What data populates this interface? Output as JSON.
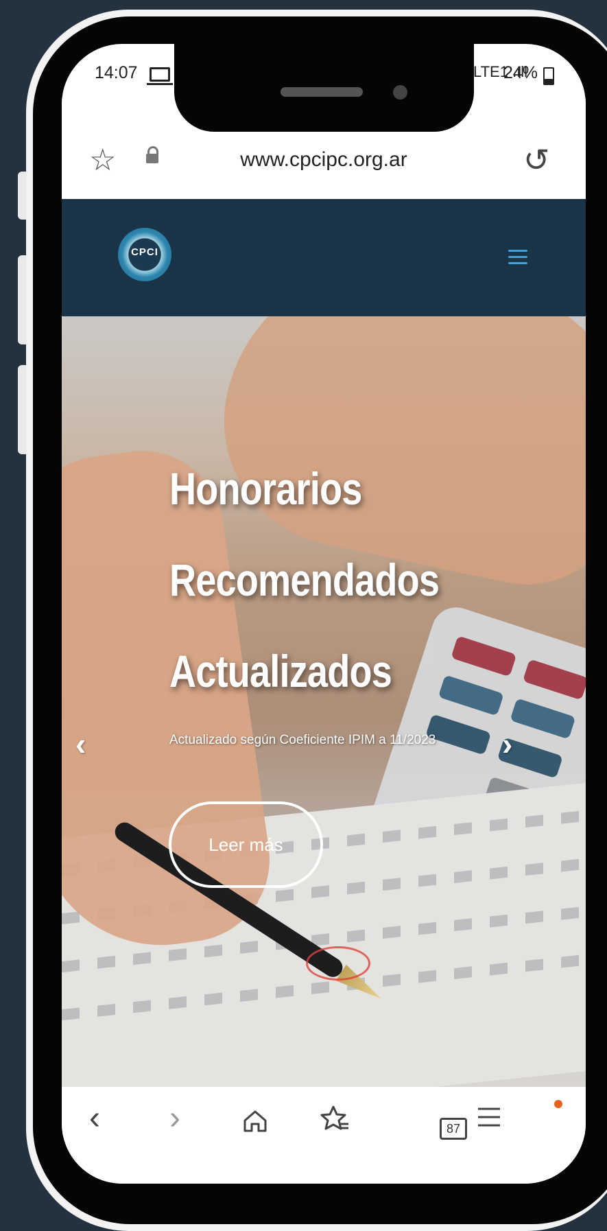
{
  "status_bar": {
    "time": "14:07",
    "signal_text": "LTE1 .ıll",
    "battery": "24%"
  },
  "browser": {
    "url": "www.cpcipc.org.ar",
    "tabs_count": "87",
    "icons": {
      "bookmark": "star-icon",
      "secure": "lock-icon",
      "reload": "reload-icon",
      "back": "back-icon",
      "forward": "forward-icon",
      "home": "home-icon",
      "bookmarks": "bookmarks-icon",
      "tabs": "tabs-icon",
      "menu": "menu-icon"
    }
  },
  "site": {
    "logo_text": "CPCI",
    "header_color": "#193447",
    "accent_color": "#3ea2dc"
  },
  "hero": {
    "title_line1": "Honorarios",
    "title_line2": "Recomendados",
    "title_line3": "Actualizados",
    "subtitle": "Actualizado según Coeficiente IPIM a 11/2023",
    "button": "Leer más",
    "prev": "‹",
    "next": "›"
  },
  "system_nav": {
    "recent": "|||",
    "back": "‹"
  }
}
